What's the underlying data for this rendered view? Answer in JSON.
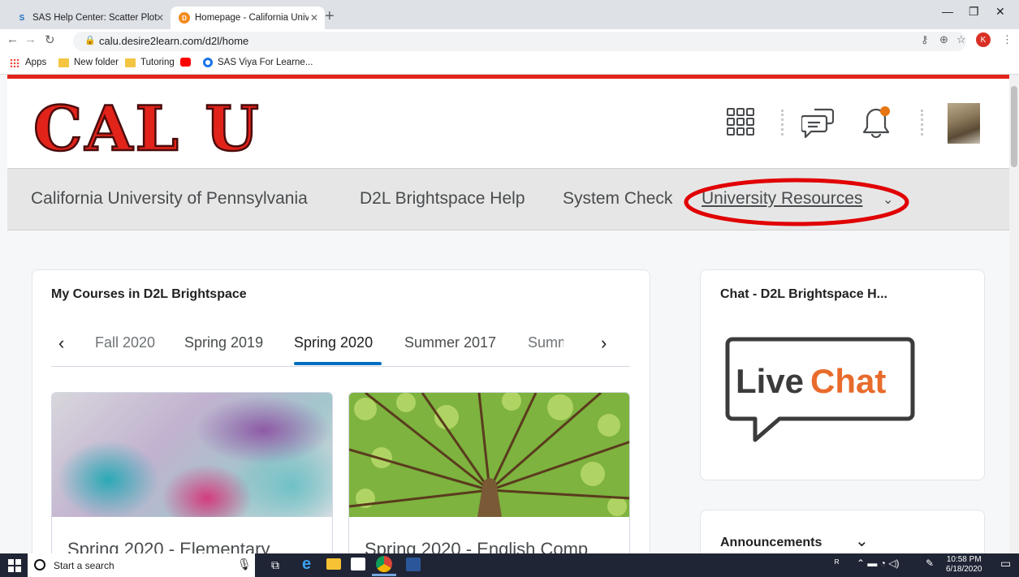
{
  "browser": {
    "tabs": [
      {
        "title": "SAS Help Center: Scatter Plot: Sel"
      },
      {
        "title": "Homepage - California University"
      }
    ],
    "url": "calu.desire2learn.com/d2l/home",
    "profile_initial": "K",
    "bookmarks": [
      {
        "label": "Apps"
      },
      {
        "label": "New folder"
      },
      {
        "label": "Tutoring"
      },
      {
        "label": ""
      },
      {
        "label": "SAS Viya For Learne..."
      }
    ]
  },
  "header": {
    "logo_text": "CAL U"
  },
  "navbar": {
    "links": [
      {
        "label": "California University of Pennsylvania"
      },
      {
        "label": "D2L Brightspace Help"
      },
      {
        "label": "System Check"
      },
      {
        "label": "University Resources"
      }
    ]
  },
  "courses_widget": {
    "title": "My Courses in D2L Brightspace",
    "semesters": [
      {
        "label": "Fall 2020"
      },
      {
        "label": "Spring 2019"
      },
      {
        "label": "Spring 2020"
      },
      {
        "label": "Summer 2017"
      },
      {
        "label": "Summer"
      }
    ],
    "selected_semester": "Spring 2020",
    "courses": [
      {
        "name": "Spring 2020 - Elementary"
      },
      {
        "name": "Spring 2020 - English Comp"
      }
    ]
  },
  "chat_widget": {
    "title": "Chat - D2L Brightspace H...",
    "logo_live": "Live",
    "logo_chat": "Chat"
  },
  "announcements_widget": {
    "title": "Announcements"
  },
  "taskbar": {
    "search_placeholder": "Start a search",
    "time": "10:58 PM",
    "date": "6/18/2020"
  },
  "colors": {
    "accent_red": "#e2231a",
    "d2l_blue": "#006fbf",
    "livechat_orange": "#e86b2c"
  }
}
